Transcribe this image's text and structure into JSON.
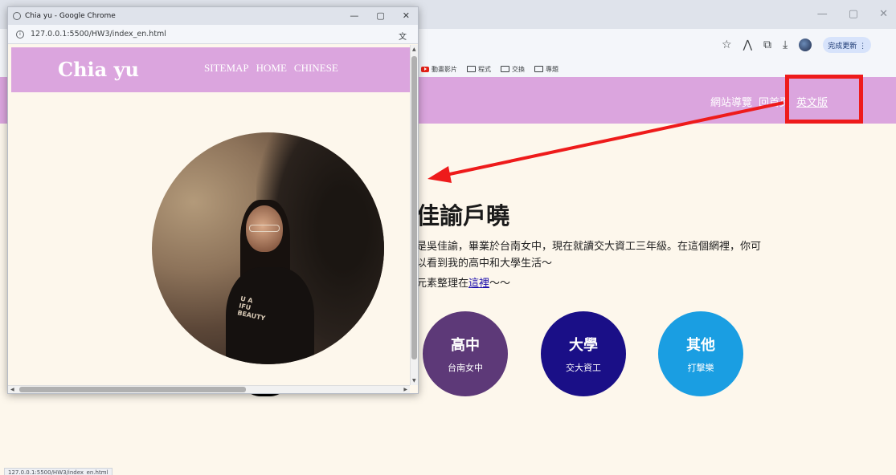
{
  "background_window": {
    "window_controls": [
      "—",
      "▢",
      "✕"
    ],
    "toolbar": {
      "update_label": "完成更新 ⋮",
      "icons": [
        "☆",
        "⋀",
        "⧉",
        "⤓"
      ]
    },
    "bookmarks": [
      {
        "icon": "youtube-icon",
        "label": "動畫影片"
      },
      {
        "icon": "folder-icon",
        "label": "程式"
      },
      {
        "icon": "folder-icon",
        "label": "交換"
      },
      {
        "icon": "folder-icon",
        "label": "專題"
      }
    ],
    "nav_links": [
      "網站導覽",
      "回首頁",
      "英文版"
    ],
    "heading": "佳諭戶曉",
    "intro": "是吳佳諭，畢業於台南女中，現在就讀交大資工三年級。在這個網裡，你可以看到我的高中和大學生活～",
    "intro2_prefix": "元素整理在",
    "intro2_link": "這裡",
    "intro2_suffix": "～～",
    "buttons": [
      {
        "title": "高中",
        "subtitle": "台南女中",
        "color": "#5d3978"
      },
      {
        "title": "大學",
        "subtitle": "交大資工",
        "color": "#1a0f87"
      },
      {
        "title": "其他",
        "subtitle": "打擊樂",
        "color": "#1a9ee2"
      }
    ],
    "status_url": "127.0.0.1:5500/HW3/index_en.html"
  },
  "popup_window": {
    "title": "Chia yu - Google Chrome",
    "window_controls": [
      "—",
      "▢",
      "✕"
    ],
    "url": "127.0.0.1:5500/HW3/index_en.html",
    "translate_icon": "文",
    "brand": "Chia yu",
    "nav_links": [
      "SITEMAP",
      "HOME",
      "CHINESE"
    ],
    "shirt_text": "U  A\nIFU\nBEAUTY"
  },
  "colors": {
    "nav_pink": "#dba5de",
    "page_bg": "#fdf7ec",
    "annotation_red": "#ee1b1b"
  }
}
